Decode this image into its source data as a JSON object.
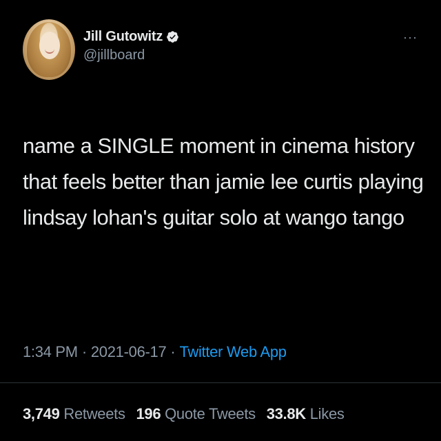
{
  "author": {
    "display_name": "Jill Gutowitz",
    "handle": "@jillboard",
    "avatar_icon": "avatar-photo",
    "verified_icon": "verified-badge-icon"
  },
  "more_icon": "more-options-icon",
  "tweet": {
    "text": "name a SINGLE moment in cinema history that feels better than jamie lee curtis playing lindsay lohan's guitar solo at wango tango",
    "time": "1:34 PM",
    "date": "2021-06-17",
    "source": "Twitter Web App",
    "separator": "·"
  },
  "stats": {
    "retweets_count": "3,749",
    "retweets_label": "Retweets",
    "quote_count": "196",
    "quote_label": "Quote Tweets",
    "likes_count": "33.8K",
    "likes_label": "Likes"
  },
  "colors": {
    "background": "#000000",
    "text": "#e7e9ea",
    "secondary": "#8b98a5",
    "accent": "#1d9bf0"
  }
}
